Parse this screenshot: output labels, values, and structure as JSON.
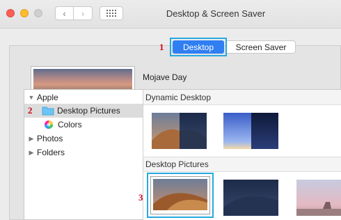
{
  "window": {
    "title": "Desktop & Screen Saver"
  },
  "toolbar": {
    "back_icon": "‹",
    "forward_icon": "›",
    "grid_icon": "⠿"
  },
  "tabs": {
    "desktop": "Desktop",
    "screen_saver": "Screen Saver"
  },
  "current_wallpaper": {
    "name": "Mojave Day"
  },
  "steps": {
    "one": "1",
    "two": "2",
    "three": "3"
  },
  "sidebar": {
    "group_label": "Apple",
    "items": [
      {
        "label": "Desktop Pictures",
        "icon": "folder-icon",
        "selected": true
      },
      {
        "label": "Colors",
        "icon": "color-wheel-icon"
      }
    ],
    "other_groups": [
      "Photos",
      "Folders"
    ]
  },
  "sections": {
    "dynamic": "Dynamic Desktop",
    "pictures": "Desktop Pictures"
  },
  "colors": {
    "accent": "#2f7ef2",
    "highlight": "#26a9e0",
    "step_red": "#d0021b"
  }
}
